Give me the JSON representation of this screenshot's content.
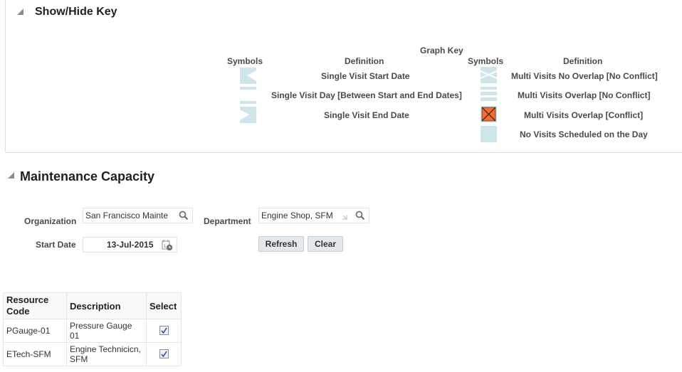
{
  "key_panel": {
    "title": "Show/Hide Key",
    "graph_key_title": "Graph Key",
    "left_headers": {
      "symbols": "Symbols",
      "definition": "Definition"
    },
    "right_headers": {
      "symbols": "Symbols",
      "definition": "Definition"
    },
    "left_items": [
      {
        "icon": "single-visit-start-icon",
        "definition": "Single Visit Start Date"
      },
      {
        "icon": "single-visit-day-icon",
        "definition": "Single Visit Day [Between Start and End Dates]"
      },
      {
        "icon": "single-visit-end-icon",
        "definition": "Single Visit End Date"
      }
    ],
    "right_items": [
      {
        "icon": "multi-visit-no-overlap-icon",
        "definition": "Multi Visits No Overlap [No Conflict]"
      },
      {
        "icon": "multi-visit-overlap-icon",
        "definition": "Multi Visits Overlap [No Conflict]"
      },
      {
        "icon": "multi-visit-conflict-icon",
        "definition": "Multi Visits Overlap [Conflict]"
      },
      {
        "icon": "no-visit-icon",
        "definition": "No Visits Scheduled on the Day"
      }
    ],
    "colors": {
      "symbol": "#cfe5ec",
      "conflict": "#ff6a2b"
    }
  },
  "capacity": {
    "title": "Maintenance Capacity",
    "organization_label": "Organization",
    "organization_value": "San Francisco Mainte",
    "department_label": "Department",
    "department_value": "Engine Shop, SFM",
    "start_date_label": "Start Date",
    "start_date_value": "13-Jul-2015",
    "refresh_label": "Refresh",
    "clear_label": "Clear"
  },
  "resources": {
    "headers": {
      "code_line1": "Resource",
      "code_line2": "Code",
      "description": "Description",
      "select": "Select"
    },
    "rows": [
      {
        "code": "PGauge-01",
        "desc1": "Pressure Gauge",
        "desc2": "01",
        "selected": true
      },
      {
        "code": "ETech-SFM",
        "desc1": "Engine Technicicn,",
        "desc2": "SFM",
        "selected": true
      }
    ]
  }
}
